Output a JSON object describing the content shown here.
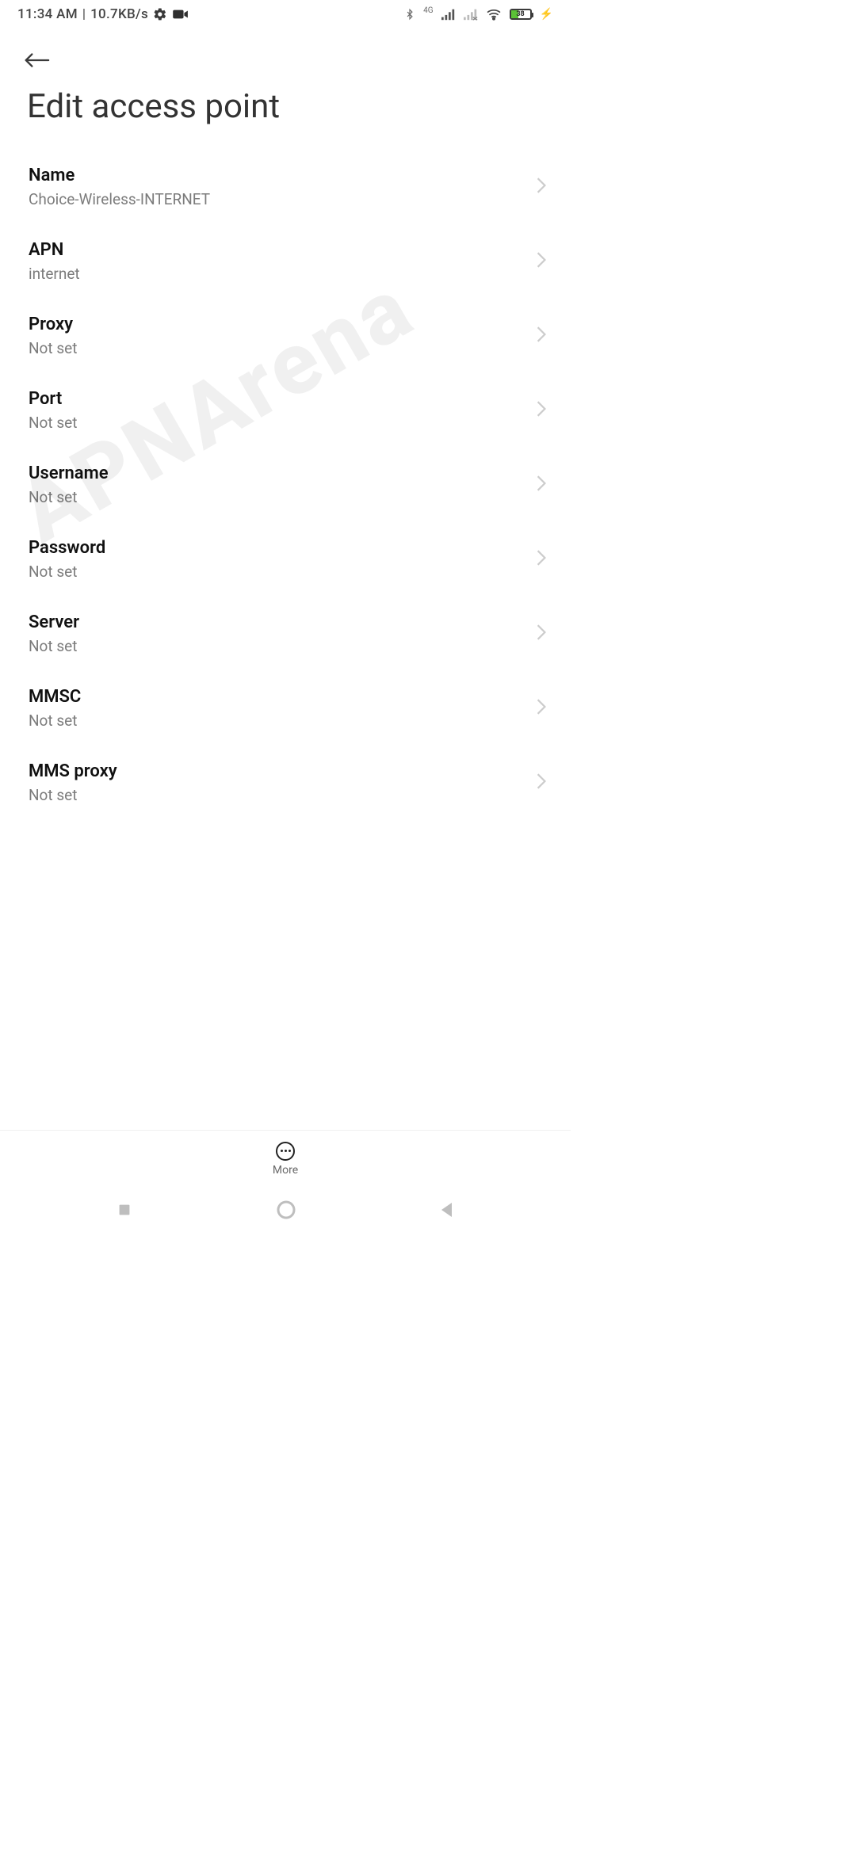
{
  "status": {
    "time": "11:34 AM",
    "separator": "|",
    "net_speed": "10.7KB/s",
    "left_icons": [
      {
        "name": "gear-icon"
      },
      {
        "name": "videocam-icon"
      }
    ],
    "right": {
      "bluetooth": {
        "name": "bluetooth-icon"
      },
      "network_label": "4G",
      "signal1": {
        "name": "signal-bars-icon"
      },
      "signal2": {
        "name": "signal-bars-x-icon"
      },
      "wifi": {
        "name": "wifi-icon"
      },
      "battery_percent": "38",
      "battery_level_width": "38%",
      "charging": {
        "name": "charging-bolt-icon"
      }
    }
  },
  "header": {
    "back": {
      "name": "arrow-back-icon"
    },
    "title": "Edit access point"
  },
  "fields": [
    {
      "label": "Name",
      "value": "Choice-Wireless-INTERNET"
    },
    {
      "label": "APN",
      "value": "internet"
    },
    {
      "label": "Proxy",
      "value": "Not set"
    },
    {
      "label": "Port",
      "value": "Not set"
    },
    {
      "label": "Username",
      "value": "Not set"
    },
    {
      "label": "Password",
      "value": "Not set"
    },
    {
      "label": "Server",
      "value": "Not set"
    },
    {
      "label": "MMSC",
      "value": "Not set"
    },
    {
      "label": "MMS proxy",
      "value": "Not set"
    }
  ],
  "toolbar": {
    "more_label": "More",
    "more": {
      "name": "more-icon"
    }
  },
  "nav": {
    "recent": {
      "name": "recent-apps-icon"
    },
    "home": {
      "name": "home-icon"
    },
    "back": {
      "name": "nav-back-icon"
    }
  },
  "watermark_text": "APNArena"
}
